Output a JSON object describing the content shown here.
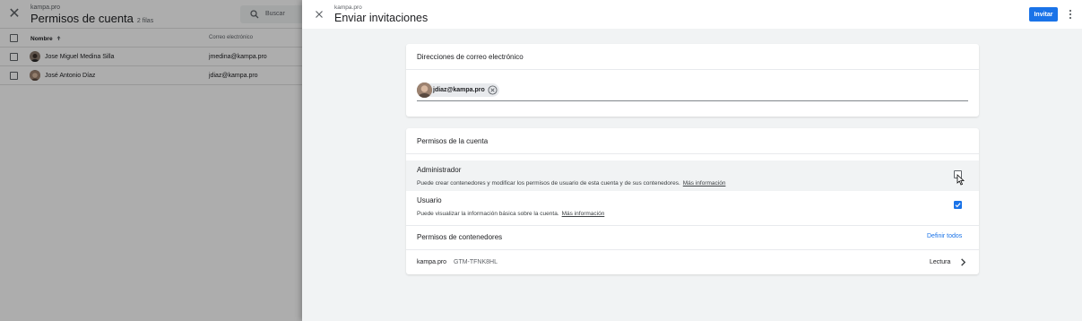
{
  "background": {
    "account": "kampa.pro",
    "title": "Permisos de cuenta",
    "rows_count": "2 filas",
    "search_placeholder": "Buscar",
    "columns": {
      "name": "Nombre",
      "email": "Correo electrónico"
    },
    "rows": [
      {
        "name": "Jose Miguel Medina Silla",
        "email": "jmedina@kampa.pro"
      },
      {
        "name": "José Antonio Díaz",
        "email": "jdiaz@kampa.pro"
      }
    ],
    "sort_icon": "arrow-up-icon"
  },
  "dialog": {
    "account": "kampa.pro",
    "title": "Enviar invitaciones",
    "invite_label": "Invitar",
    "emails_card": {
      "title": "Direcciones de correo electrónico",
      "chips": [
        {
          "email": "jdiaz@kampa.pro"
        }
      ]
    },
    "permissions_card": {
      "title": "Permisos de la cuenta",
      "roles": [
        {
          "name": "Administrador",
          "description": "Puede crear contenedores y modificar los permisos de usuario de esta cuenta y de sus contenedores.",
          "link": "Más información",
          "checked": false
        },
        {
          "name": "Usuario",
          "description": "Puede visualizar la información básica sobre la cuenta.",
          "link": "Más información",
          "checked": true
        }
      ],
      "containers_title": "Permisos de contenedores",
      "set_all_label": "Definir todos",
      "containers": [
        {
          "account": "kampa.pro",
          "id": "GTM-TFNK8HL",
          "permission": "Lectura"
        }
      ]
    }
  },
  "colors": {
    "accent": "#1a73e8",
    "overlay": "rgba(0,0,0,0.32)",
    "dialog_bg": "#f1f3f4"
  }
}
